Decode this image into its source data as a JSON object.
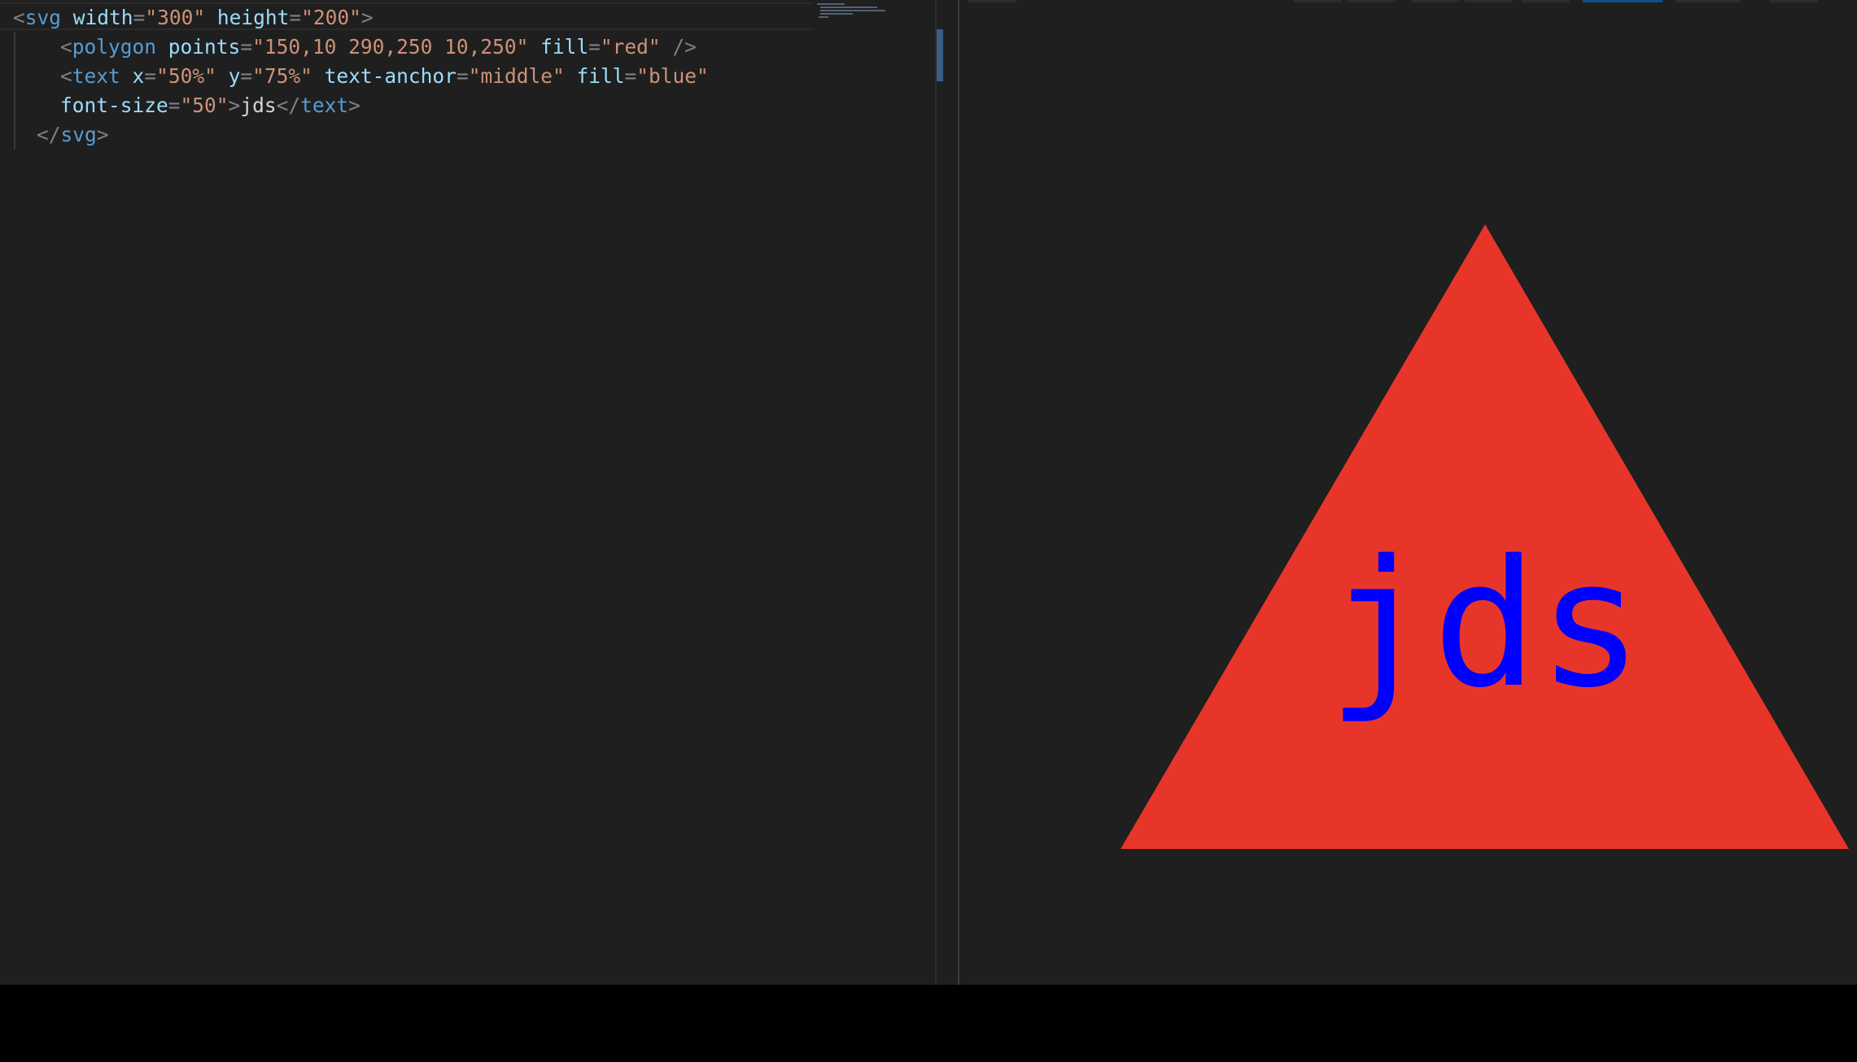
{
  "editor": {
    "lines": [
      {
        "tokens": [
          {
            "t": "punc",
            "v": "<"
          },
          {
            "t": "tag",
            "v": "svg"
          },
          {
            "t": "text",
            "v": " "
          },
          {
            "t": "attr",
            "v": "width"
          },
          {
            "t": "punc",
            "v": "="
          },
          {
            "t": "val",
            "v": "\"300\""
          },
          {
            "t": "text",
            "v": " "
          },
          {
            "t": "attr",
            "v": "height"
          },
          {
            "t": "punc",
            "v": "="
          },
          {
            "t": "val",
            "v": "\"200\""
          },
          {
            "t": "punc",
            "v": ">"
          }
        ]
      },
      {
        "indent": 1,
        "tokens": [
          {
            "t": "punc",
            "v": "<"
          },
          {
            "t": "tag",
            "v": "polygon"
          },
          {
            "t": "text",
            "v": " "
          },
          {
            "t": "attr",
            "v": "points"
          },
          {
            "t": "punc",
            "v": "="
          },
          {
            "t": "val",
            "v": "\"150,10 290,250 10,250\""
          },
          {
            "t": "text",
            "v": " "
          },
          {
            "t": "attr",
            "v": "fill"
          },
          {
            "t": "punc",
            "v": "="
          },
          {
            "t": "val",
            "v": "\"red\""
          },
          {
            "t": "text",
            "v": " "
          },
          {
            "t": "punc",
            "v": "/>"
          }
        ]
      },
      {
        "indent": 1,
        "tokens": [
          {
            "t": "punc",
            "v": "<"
          },
          {
            "t": "tag",
            "v": "text"
          },
          {
            "t": "text",
            "v": " "
          },
          {
            "t": "attr",
            "v": "x"
          },
          {
            "t": "punc",
            "v": "="
          },
          {
            "t": "val",
            "v": "\"50%\""
          },
          {
            "t": "text",
            "v": " "
          },
          {
            "t": "attr",
            "v": "y"
          },
          {
            "t": "punc",
            "v": "="
          },
          {
            "t": "val",
            "v": "\"75%\""
          },
          {
            "t": "text",
            "v": " "
          },
          {
            "t": "attr",
            "v": "text-anchor"
          },
          {
            "t": "punc",
            "v": "="
          },
          {
            "t": "val",
            "v": "\"middle\""
          },
          {
            "t": "text",
            "v": " "
          },
          {
            "t": "attr",
            "v": "fill"
          },
          {
            "t": "punc",
            "v": "="
          },
          {
            "t": "val",
            "v": "\"blue\""
          }
        ]
      },
      {
        "indent": 1,
        "tokens": [
          {
            "t": "attr",
            "v": "font-size"
          },
          {
            "t": "punc",
            "v": "="
          },
          {
            "t": "val",
            "v": "\"50\""
          },
          {
            "t": "punc",
            "v": ">"
          },
          {
            "t": "text",
            "v": "jds"
          },
          {
            "t": "punc",
            "v": "</"
          },
          {
            "t": "tag",
            "v": "text"
          },
          {
            "t": "punc",
            "v": ">"
          }
        ]
      },
      {
        "indent": 0.5,
        "tokens": [
          {
            "t": "punc",
            "v": "</"
          },
          {
            "t": "tag",
            "v": "svg"
          },
          {
            "t": "punc",
            "v": ">"
          }
        ]
      }
    ]
  },
  "preview": {
    "text": "jds",
    "triangle_color": "#e8352a",
    "text_color": "#0000ff"
  },
  "colors": {
    "background": "#1f1f1f",
    "tag": "#569cd6",
    "attribute": "#9cdcfe",
    "string": "#ce9178",
    "punctuation": "#808080",
    "text": "#d4d4d4",
    "accent": "#0e4f8a"
  }
}
